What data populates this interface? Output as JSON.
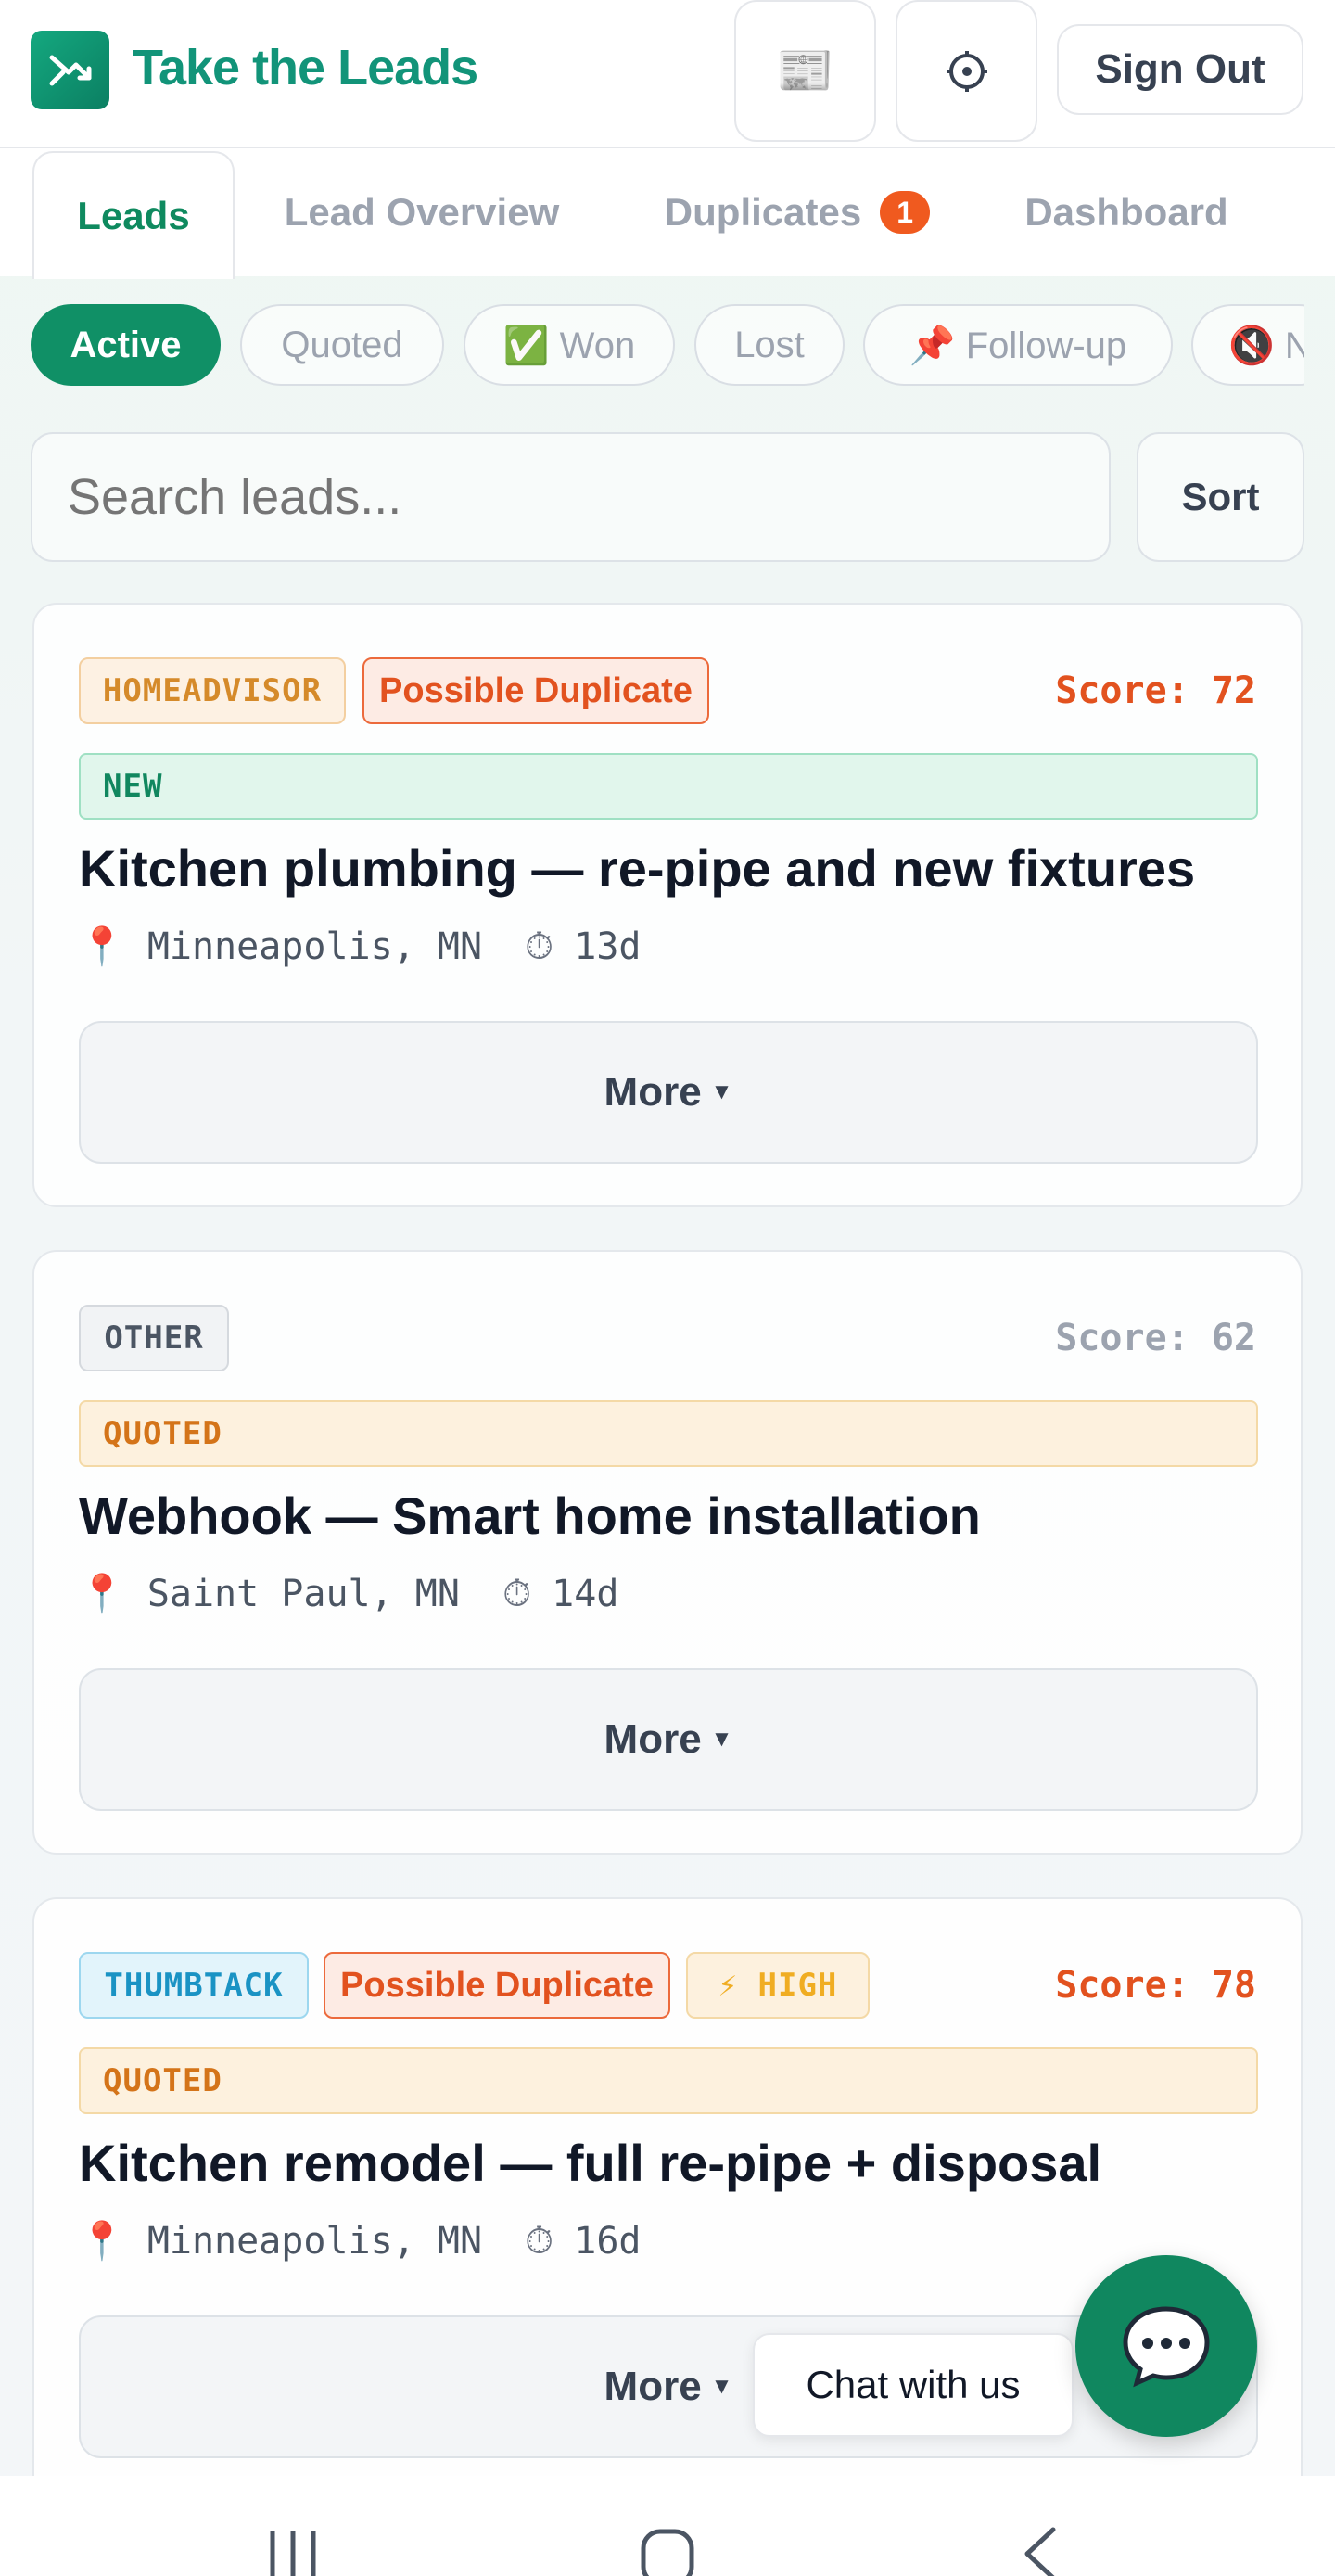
{
  "header": {
    "brand": "Take the Leads",
    "news_icon": "newspaper-icon",
    "settings_icon": "target-icon",
    "sign_out_label": "Sign Out"
  },
  "tabs": [
    {
      "label": "Leads",
      "active": true
    },
    {
      "label": "Lead Overview"
    },
    {
      "label": "Duplicates",
      "badge": "1"
    },
    {
      "label": "Dashboard"
    }
  ],
  "filters": [
    {
      "label": "Active",
      "active": true
    },
    {
      "label": "Quoted"
    },
    {
      "label": "✅ Won"
    },
    {
      "label": "Lost"
    },
    {
      "label": "📌 Follow-up"
    },
    {
      "label": "🔇 N"
    }
  ],
  "search": {
    "placeholder": "Search leads...",
    "sort_label": "Sort"
  },
  "leads": [
    {
      "source": "HOMEADVISOR",
      "duplicate": "Possible Duplicate",
      "score": "Score: 72",
      "status": "NEW",
      "title": "Kitchen plumbing — re-pipe and new fixtures",
      "location": "Minneapolis, MN",
      "age": "13d",
      "more": "More"
    },
    {
      "source": "OTHER",
      "score": "Score: 62",
      "status": "QUOTED",
      "title": "Webhook — Smart home installation",
      "location": "Saint Paul, MN",
      "age": "14d",
      "more": "More"
    },
    {
      "source": "THUMBTACK",
      "duplicate": "Possible Duplicate",
      "priority": "⚡ HIGH",
      "score": "Score: 78",
      "status": "QUOTED",
      "title": "Kitchen remodel — full re-pipe + disposal",
      "location": "Minneapolis, MN",
      "age": "16d",
      "more": "More"
    }
  ],
  "chat": {
    "label": "Chat with us"
  },
  "colors": {
    "brand": "#129479",
    "accent": "#109066",
    "duplicate": "#e2521f",
    "score_high": "#e2521f"
  }
}
